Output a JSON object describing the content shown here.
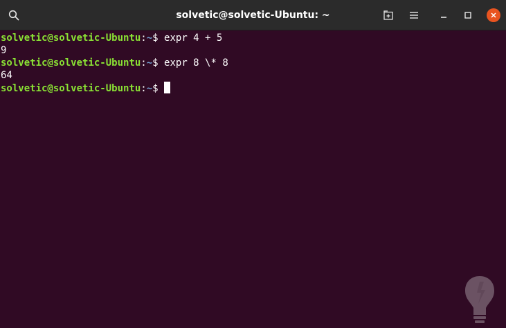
{
  "window": {
    "title": "solvetic@solvetic-Ubuntu: ~"
  },
  "icons": {
    "search": "search-icon",
    "new_tab": "new-tab-icon",
    "menu": "hamburger-menu-icon",
    "minimize": "minimize-icon",
    "maximize": "maximize-icon",
    "close": "close-icon"
  },
  "colors": {
    "terminal_background": "#300a24",
    "prompt_user": "#8ae234",
    "prompt_path": "#729fcf",
    "close_button": "#e95420"
  },
  "terminal": {
    "lines": [
      {
        "user": "solvetic@solvetic-Ubuntu",
        "sep": ":",
        "path": "~",
        "dollar": "$ ",
        "command": "expr 4 + 5"
      },
      {
        "output": "9"
      },
      {
        "user": "solvetic@solvetic-Ubuntu",
        "sep": ":",
        "path": "~",
        "dollar": "$ ",
        "command": "expr 8 \\* 8"
      },
      {
        "output": "64"
      },
      {
        "user": "solvetic@solvetic-Ubuntu",
        "sep": ":",
        "path": "~",
        "dollar": "$ ",
        "command": ""
      }
    ]
  }
}
